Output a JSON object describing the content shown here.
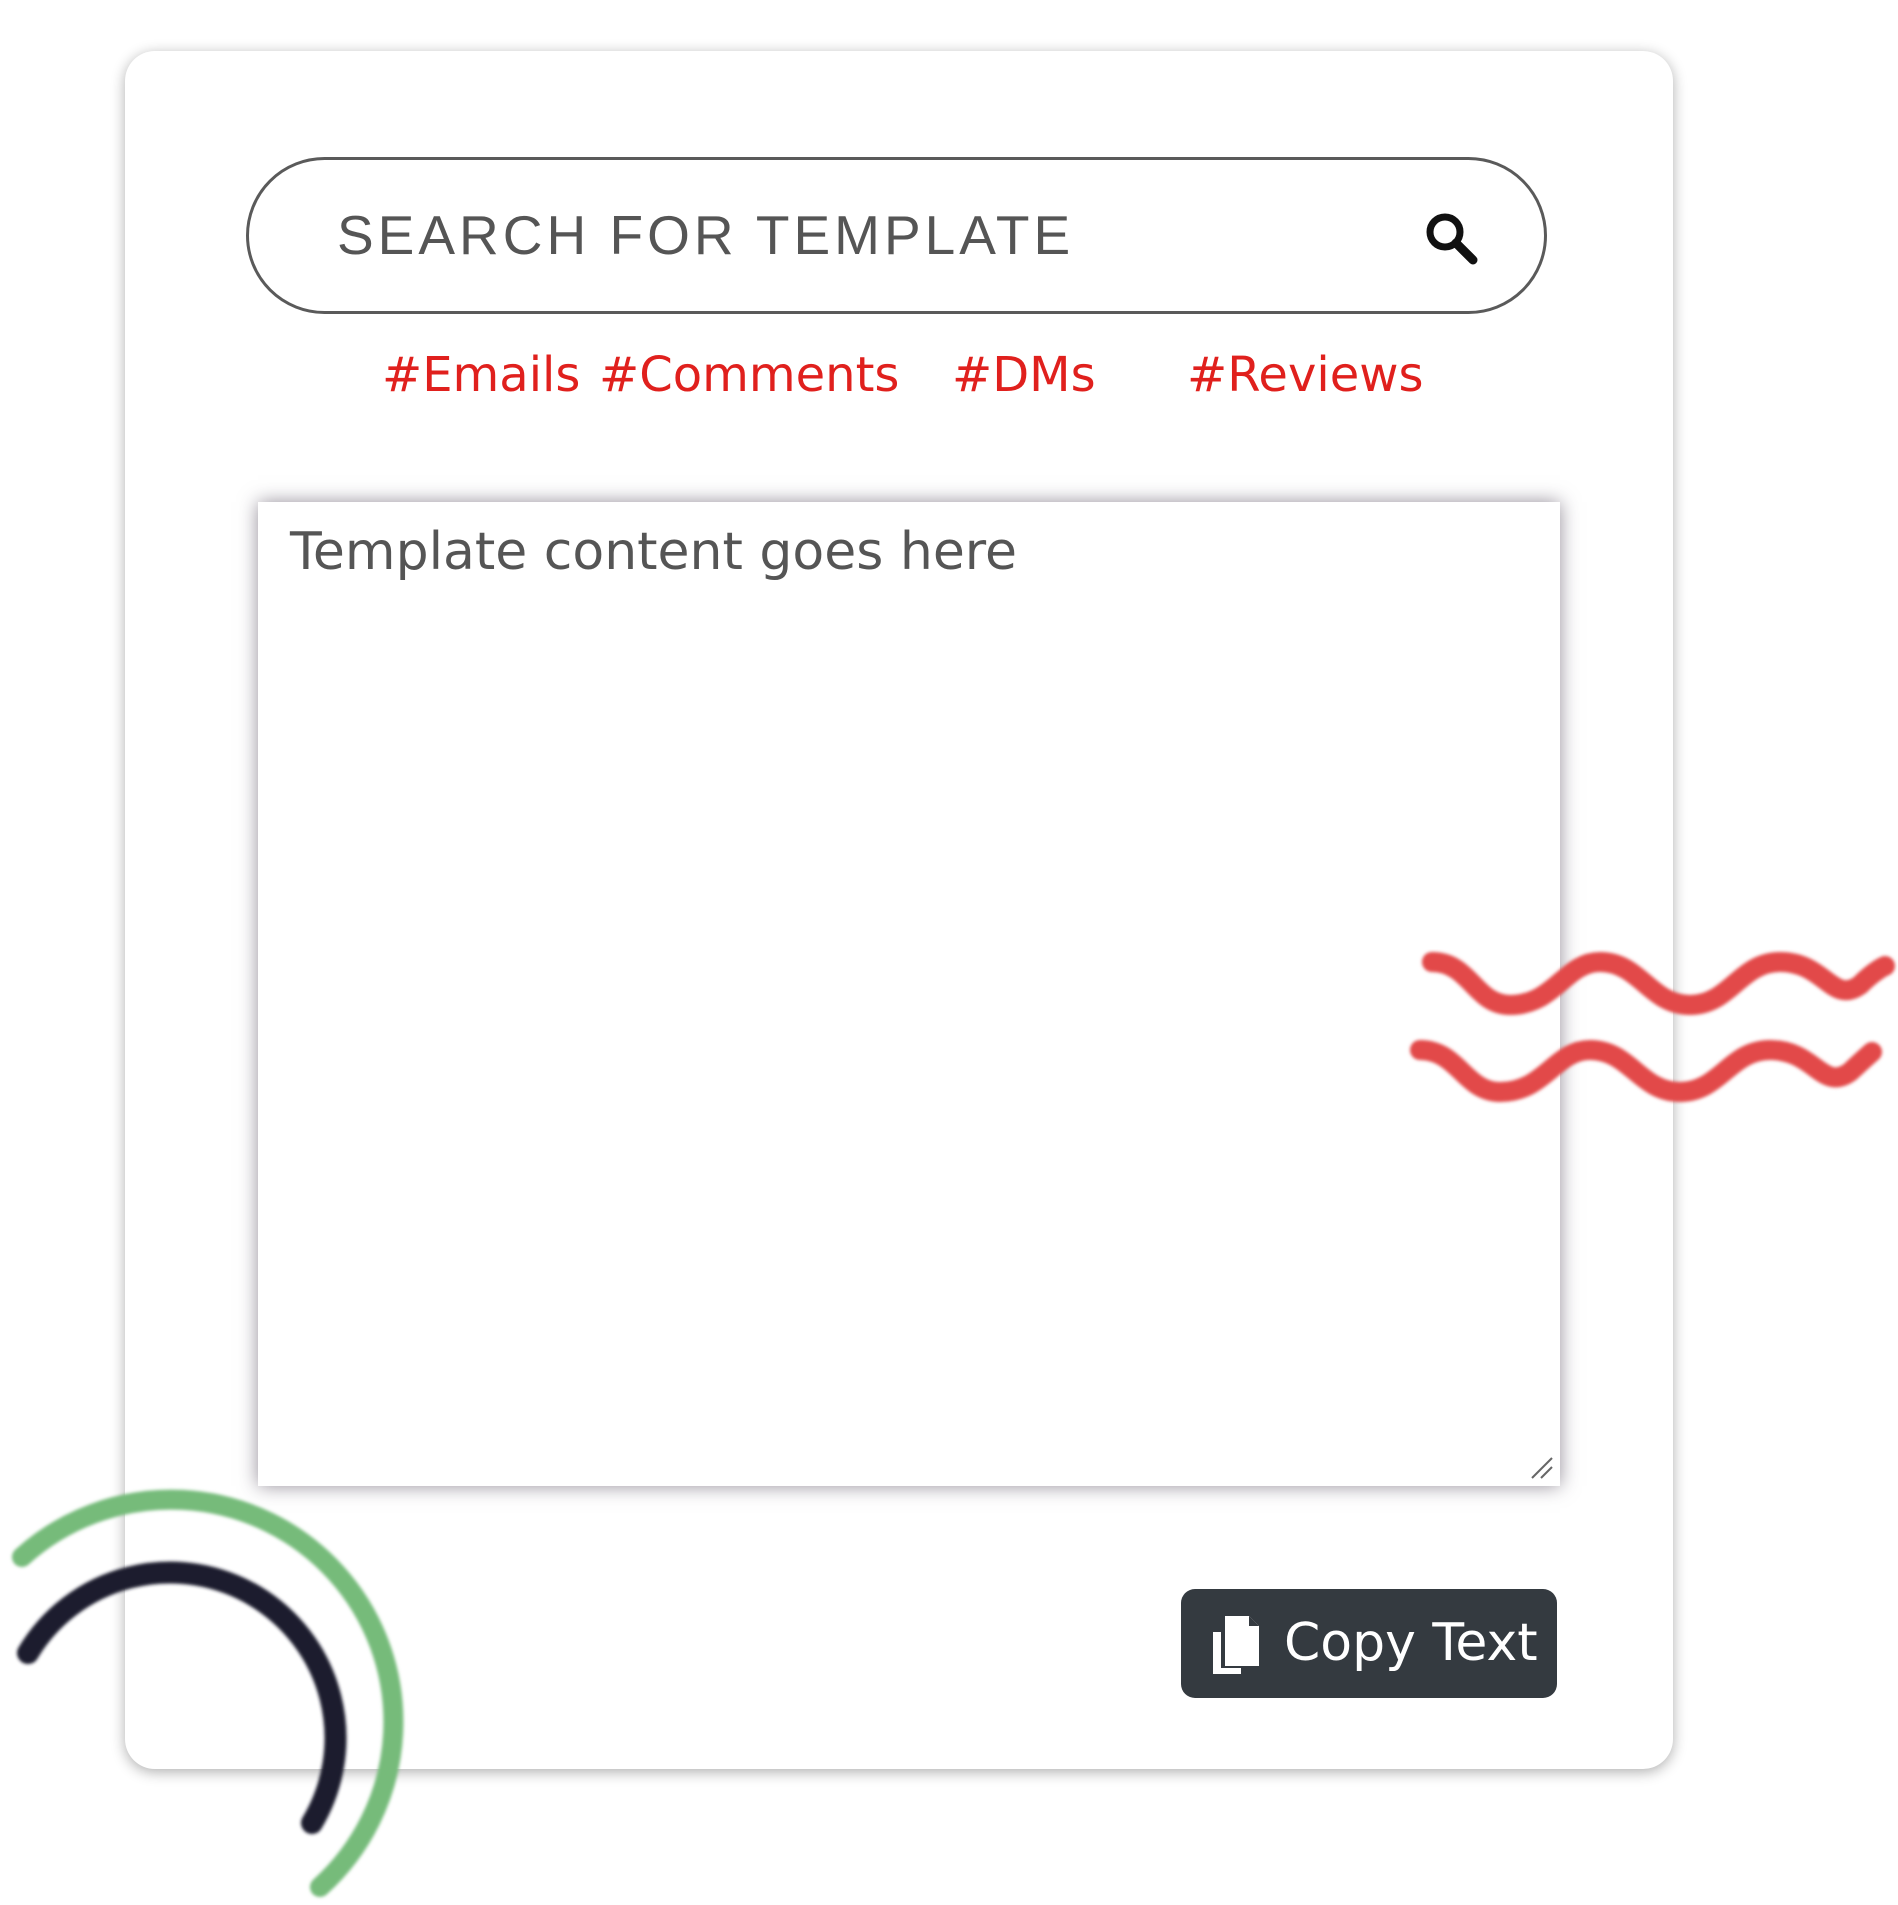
{
  "search": {
    "placeholder": "SEARCH FOR TEMPLATE",
    "value": "",
    "icon": "search-icon"
  },
  "tags": [
    {
      "label": "#Emails"
    },
    {
      "label": "#Comments"
    },
    {
      "label": "#DMs"
    },
    {
      "label": "#Reviews"
    }
  ],
  "template_editor": {
    "placeholder": "Template content goes here",
    "value": ""
  },
  "copy_button": {
    "label": "Copy Text",
    "icon": "copy-icon"
  },
  "colors": {
    "tag_red": "#e0201d",
    "button_dark": "#343a40",
    "wave_red": "#e24a4a",
    "arc_green": "#76bb7a",
    "arc_navy": "#1b1f2e"
  }
}
